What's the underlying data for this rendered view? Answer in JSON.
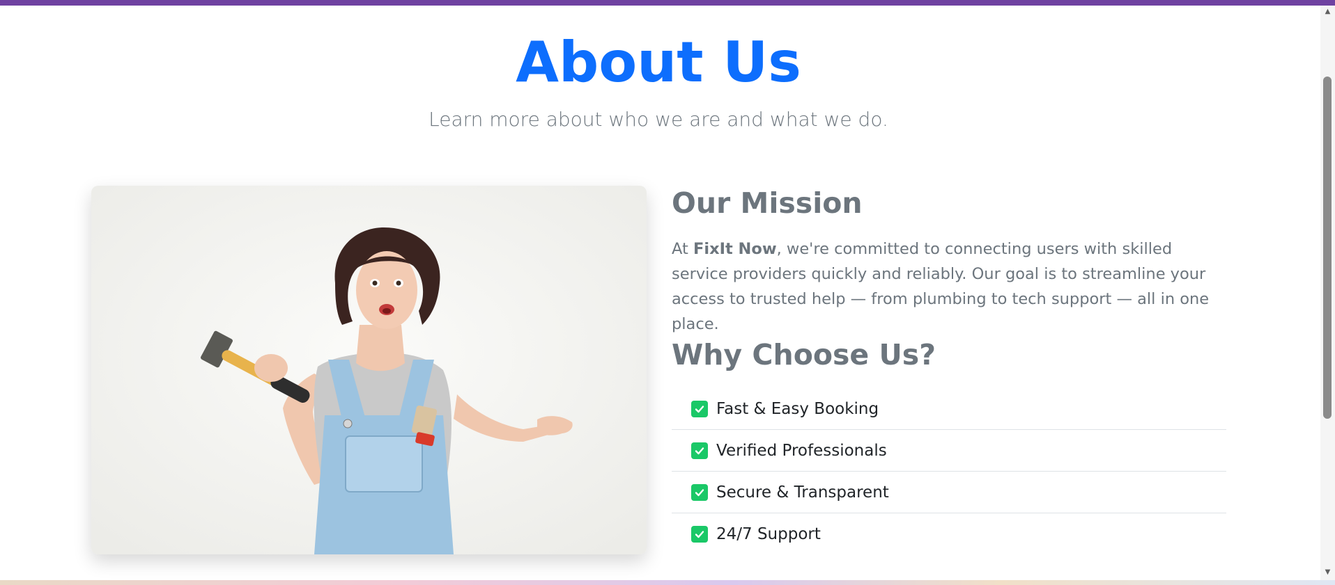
{
  "header": {
    "title": "About Us",
    "subtitle": "Learn more about who we are and what we do."
  },
  "image": {
    "subject": "Smiling woman in denim overalls holding a hammer, paintbrush in pocket"
  },
  "mission": {
    "title": "Our Mission",
    "text_prefix": "At ",
    "brand": "FixIt Now",
    "text_suffix": ", we're committed to connecting users with skilled service providers quickly and reliably. Our goal is to streamline your access to trusted help — from plumbing to tech support — all in one place."
  },
  "why": {
    "title": "Why Choose Us?",
    "items": [
      {
        "label": "Fast & Easy Booking",
        "icon": "check-square-icon"
      },
      {
        "label": "Verified Professionals",
        "icon": "check-square-icon"
      },
      {
        "label": "Secure & Transparent",
        "icon": "check-square-icon"
      },
      {
        "label": "24/7 Support",
        "icon": "check-square-icon"
      }
    ]
  },
  "colors": {
    "accent": "#0d6efd",
    "top_bar": "#6f42a1",
    "check": "#1ac867",
    "muted_text": "#6c757d"
  }
}
